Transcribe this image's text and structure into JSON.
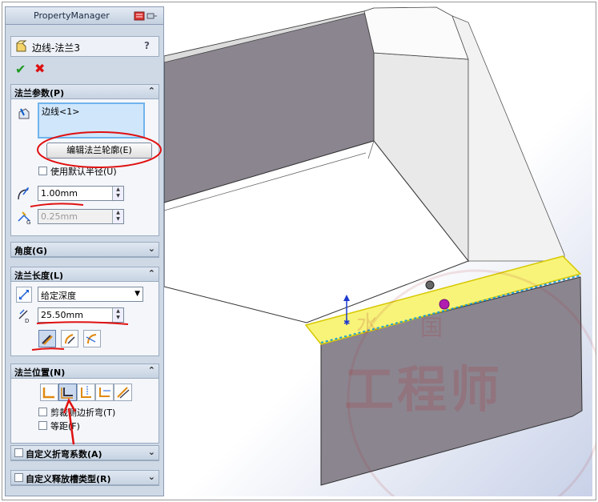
{
  "property_manager": {
    "title": "PropertyManager",
    "feature_title": "边线-法兰3",
    "help": "?",
    "confirm": "✔",
    "cancel": "✖"
  },
  "flange_params": {
    "header": "法兰参数(P)",
    "edge_item": "边线<1>",
    "edit_button": "编辑法兰轮廓(E)",
    "use_default_radius": "使用默认半径(U)",
    "radius_value": "1.00mm",
    "gap_value": "0.25mm"
  },
  "angle_group": {
    "header": "角度(G)"
  },
  "flange_length": {
    "header": "法兰长度(L)",
    "end_condition": "给定深度",
    "length_value": "25.50mm"
  },
  "flange_position": {
    "header": "法兰位置(N)",
    "trim_side_bends": "剪裁侧边折弯(T)",
    "offset": "等距(F)"
  },
  "custom_bend": {
    "header": "自定义折弯系数(A)"
  },
  "custom_relief": {
    "header": "自定义释放槽类型(R)"
  },
  "watermark": {
    "seal_chars": [
      "水",
      "国"
    ],
    "text": "工程师"
  },
  "colors": {
    "panel_bg": "#cfd9e6",
    "highlight_face": "#f8f47a",
    "part_gray": "#8b8590",
    "markup_red": "#e01010"
  }
}
